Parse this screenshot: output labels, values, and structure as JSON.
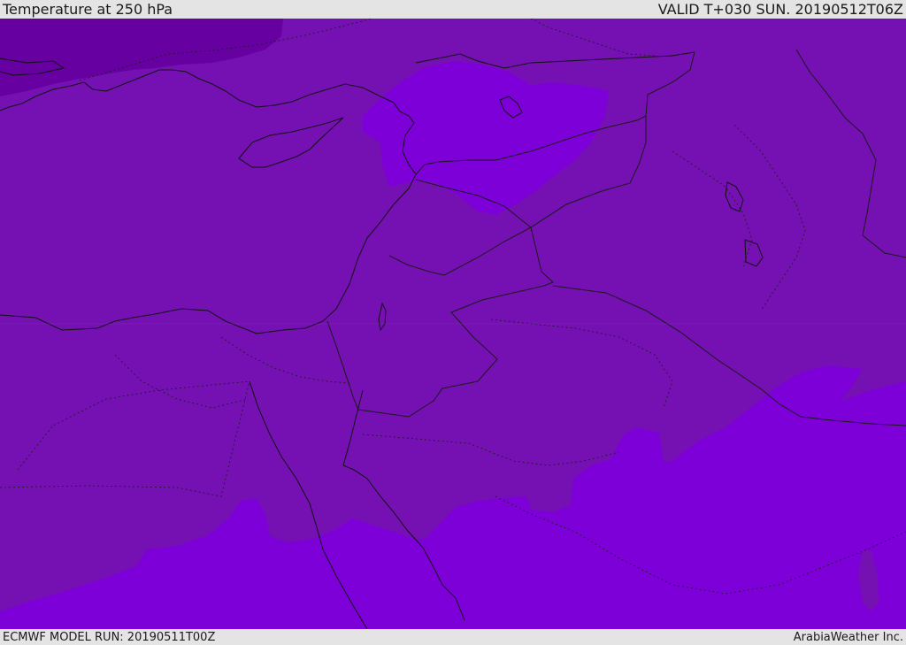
{
  "header": {
    "title": "Temperature at 250 hPa",
    "valid": "VALID T+030 SUN. 20190512T06Z"
  },
  "footer": {
    "model_run": "ECMWF MODEL RUN: 20190511T00Z",
    "credit": "ArabiaWeather Inc."
  },
  "map": {
    "colors": {
      "base": "#7510b2",
      "warm_band": "#7e00d8",
      "cold_band": "#6600a0",
      "coast": "#111111",
      "border": "#1a1a1a"
    }
  }
}
